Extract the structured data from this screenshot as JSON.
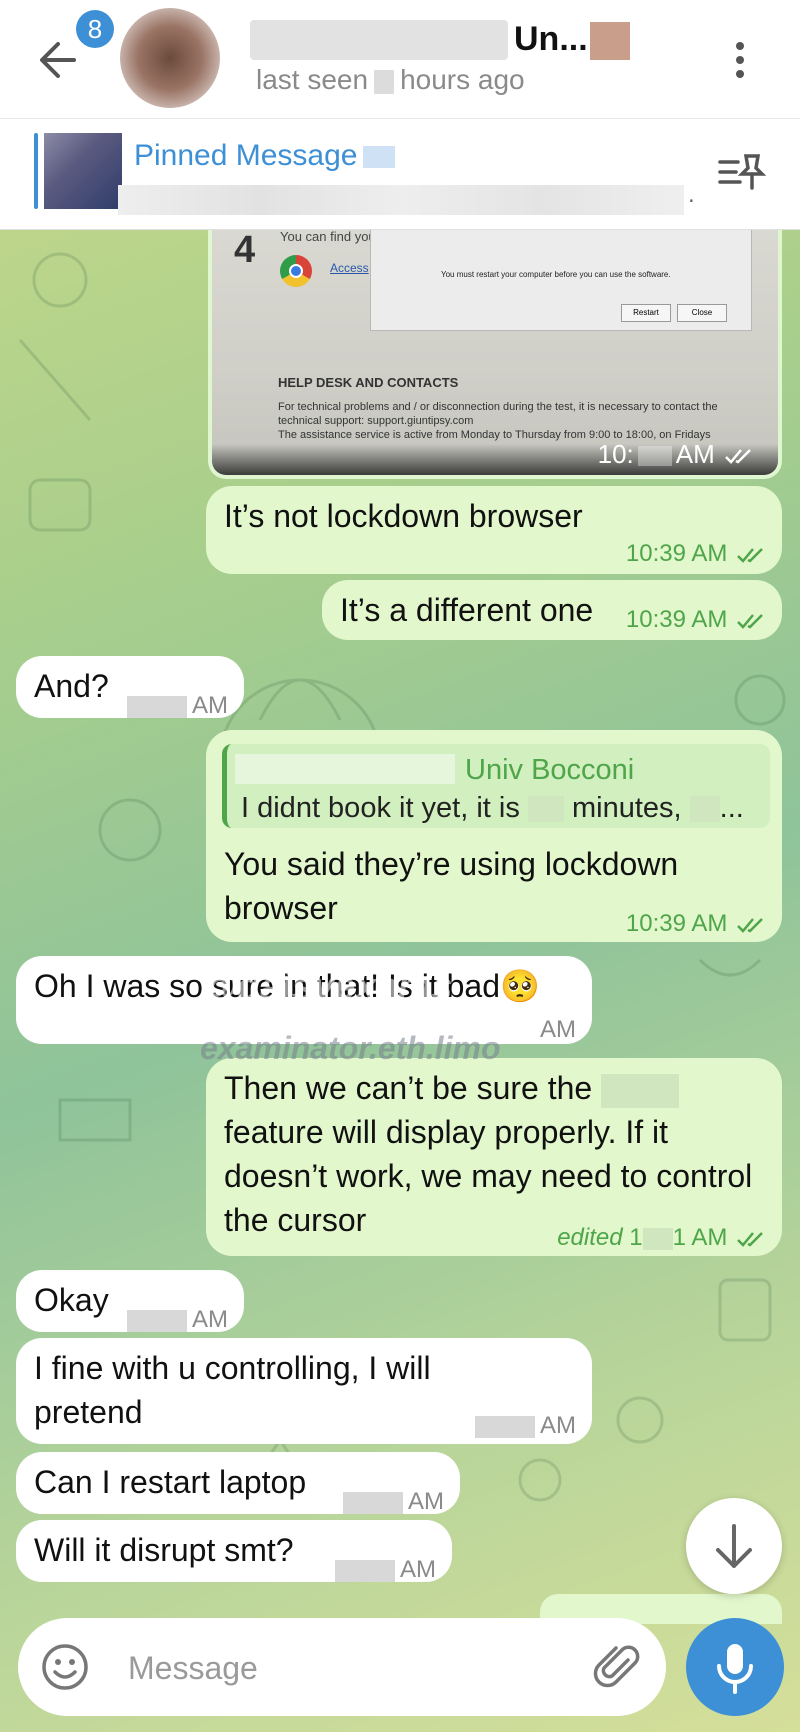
{
  "header": {
    "unread_badge": "8",
    "chat_title": "Un...",
    "last_seen_prefix": "last seen",
    "last_seen_suffix": "hours ago"
  },
  "pinned": {
    "label": "Pinned Message",
    "text_end": "."
  },
  "photo_message": {
    "step_number": "4",
    "find_text": "You can find you",
    "access_link": "Access",
    "dialog_text": "You must restart your computer before you can use the software.",
    "dialog_restart": "Restart",
    "dialog_close": "Close",
    "help_title": "HELP DESK AND CONTACTS",
    "help_line1": "For technical problems and / or disconnection during the test, it is necessary to contact the",
    "help_line2": "technical support: support.giuntipsy.com",
    "help_line3": "The assistance service is active from Monday to Thursday from 9:00 to 18:00, on Fridays",
    "time_prefix": "10:",
    "time_suffix": "AM"
  },
  "messages": [
    {
      "text": "It’s not lockdown browser",
      "time": "10:39 AM"
    },
    {
      "text": "It’s a different one",
      "time": "10:39 AM"
    },
    {
      "text": "And?",
      "time": "AM"
    },
    {
      "reply_name": "Univ Bocconi",
      "reply_text_a": "I didnt book it yet, it is",
      "reply_text_b": "minutes,",
      "reply_text_c": "...",
      "text": "You said they’re using lockdown browser",
      "time": "10:39 AM"
    },
    {
      "text": "Oh I was so sure in that! Is it bad🥺",
      "time": "AM"
    },
    {
      "text_line1": "Then we can’t be sure the",
      "text_rest": "feature will display properly. If it doesn’t work, we may need to control the cursor",
      "edited": "edited",
      "time_prefix": "1",
      "time_suffix": "1 AM"
    },
    {
      "text": "Okay",
      "time": "AM"
    },
    {
      "text": "I fine with u controlling, I will pretend",
      "time": "AM"
    },
    {
      "text": "Can I restart laptop",
      "time": "AM"
    },
    {
      "text": "Will it disrupt smt?",
      "time": "AM"
    }
  ],
  "watermarks": {
    "line1": "@daisyexams",
    "line2": "examinator.eth.limo"
  },
  "input": {
    "placeholder": "Message"
  },
  "colors": {
    "accent": "#3d8fd6",
    "outgoing_bubble": "#e2f7cc",
    "incoming_bubble": "#ffffff",
    "time_green": "#4ea54a"
  }
}
